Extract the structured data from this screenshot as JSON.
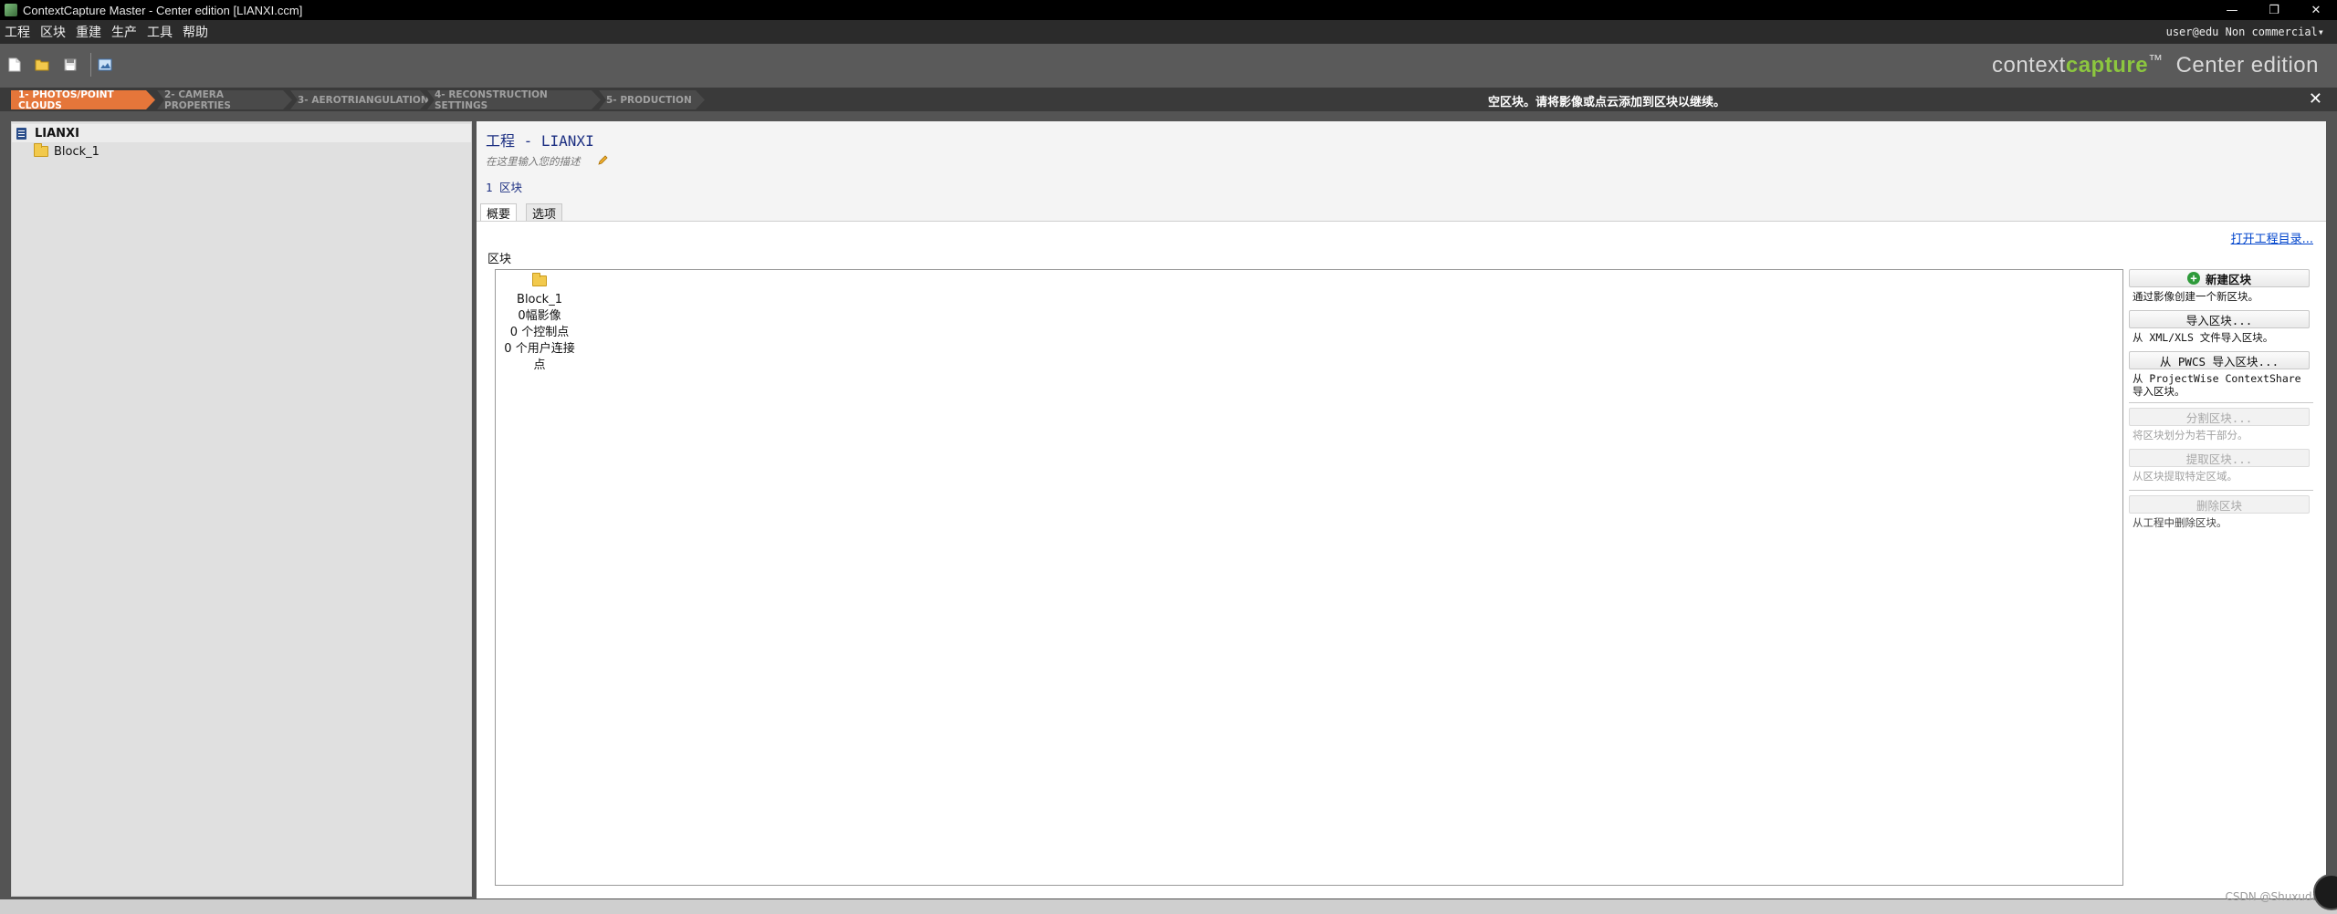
{
  "window": {
    "title": "ContextCapture Master - Center edition [LIANXI.ccm]",
    "minimize": "—",
    "restore": "❐",
    "close": "✕"
  },
  "menu": {
    "items": [
      "工程",
      "区块",
      "重建",
      "生产",
      "工具",
      "帮助"
    ],
    "user": "user@edu Non commercial▾"
  },
  "brand": {
    "context": "context",
    "capture": "capture",
    "tm": "™",
    "edition": "Center edition"
  },
  "wizard": {
    "steps": [
      {
        "label": "1- PHOTOS/POINT CLOUDS",
        "active": true
      },
      {
        "label": "2- CAMERA PROPERTIES",
        "active": false
      },
      {
        "label": "3- AEROTRIANGULATION",
        "active": false
      },
      {
        "label": "4- RECONSTRUCTION SETTINGS",
        "active": false
      },
      {
        "label": "5- PRODUCTION",
        "active": false
      }
    ],
    "message": "空区块。请将影像或点云添加到区块以继续。",
    "close": "✕"
  },
  "tree": {
    "root": "LIANXI",
    "child": "Block_1"
  },
  "project": {
    "title": "工程 - LIANXI",
    "description_placeholder": "在这里输入您的描述",
    "block_count": "1 区块",
    "tabs": [
      {
        "label": "概要",
        "active": true
      },
      {
        "label": "选项",
        "active": false
      }
    ],
    "open_dir_link": "打开工程目录...",
    "blocks_label": "区块"
  },
  "block_card": {
    "name": "Block_1",
    "photos": "0幅影像",
    "control_points": "0 个控制点",
    "user_tie_points": "0 个用户连接点"
  },
  "actions": {
    "new_block": "新建区块",
    "new_block_desc": "通过影像创建一个新区块。",
    "import_block": "导入区块...",
    "import_block_desc": "从 XML/XLS 文件导入区块。",
    "import_pwcs": "从 PWCS 导入区块...",
    "import_pwcs_desc": "从 ProjectWise ContextShare 导入区块。",
    "split_block": "分割区块...",
    "split_block_desc": "将区块划分为若干部分。",
    "extract_block": "提取区块...",
    "extract_block_desc": "从区块提取特定区域。",
    "delete_block": "删除区块",
    "delete_block_desc": "从工程中删除区块。"
  },
  "watermark": "CSDN @Shuxuda"
}
